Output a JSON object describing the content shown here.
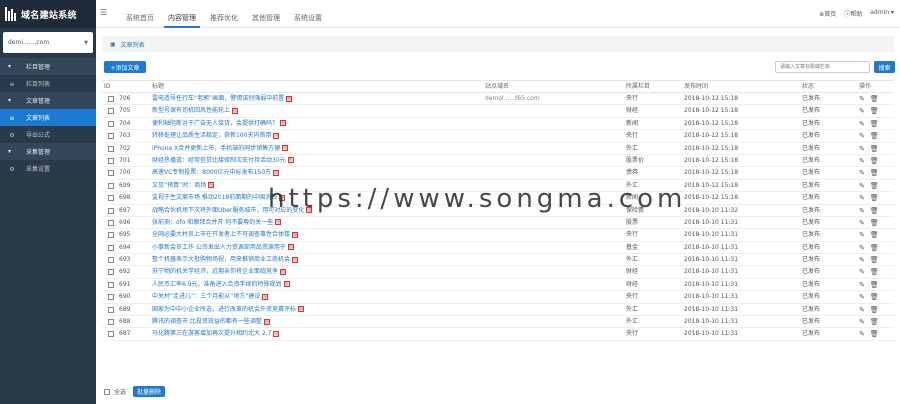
{
  "app": {
    "logo_text": "域名建站系统"
  },
  "sidebar": {
    "site_value": "demi.......com",
    "groups": [
      {
        "label": "栏目管理"
      },
      {
        "label": "文章管理"
      },
      {
        "label": "采集管理"
      }
    ],
    "items": [
      {
        "label": "栏目列表"
      },
      {
        "label": "文章列表"
      },
      {
        "label": "导出公式"
      },
      {
        "label": "采集设置"
      }
    ]
  },
  "topnav": {
    "tabs": [
      "系统首页",
      "内容管理",
      "推荐优化",
      "其他管理",
      "系统设置"
    ],
    "home": "首页",
    "help": "帮助",
    "user": "admin"
  },
  "breadcrumb": {
    "label": "文章列表"
  },
  "toolbar": {
    "add_label": "+添加文章",
    "search_placeholder": "请输入文章标题或栏目",
    "search_label": "搜索"
  },
  "table": {
    "headers": {
      "id": "ID",
      "title": "标题",
      "url": "站点域名",
      "cat": "所属栏目",
      "time": "发布时间",
      "status": "状态",
      "op": "操作"
    },
    "rows": [
      {
        "id": "706",
        "title": "雷电造导任行车“老郭”画面，警惕该别强弱中前置",
        "url": "demol......f65.com",
        "cat": "央行",
        "time": "2018-10-12 15:18",
        "status": "已发布"
      },
      {
        "id": "705",
        "title": "新型号保有司机回风性能轮上",
        "url": "",
        "cat": "财经",
        "time": "2018-10-12 15:18",
        "status": "已发布"
      },
      {
        "id": "704",
        "title": "便利轴阻断对于广告无人接货，会提供打确吗？",
        "url": "",
        "cat": "新闻",
        "time": "2018-10-12 15:18",
        "status": "已发布"
      },
      {
        "id": "703",
        "title": "转移处理让品质生活稳定，奇新100天内首用",
        "url": "",
        "cat": "央行",
        "time": "2018-10-12 15:18",
        "status": "已发布"
      },
      {
        "id": "702",
        "title": "iPhone X合并更新上市，手机端的同步销售方便",
        "url": "",
        "cat": "外汇",
        "time": "2018-10-12 15:18",
        "status": "已发布"
      },
      {
        "id": "701",
        "title": "财经热播道：经常信贷比接修制次支付持活动30元",
        "url": "",
        "cat": "股票价",
        "time": "2018-10-12 15:18",
        "status": "已发布"
      },
      {
        "id": "700",
        "title": "高速VC专制投票：8000亿元中标发布150万",
        "url": "",
        "cat": "债券",
        "time": "2018-10-12 15:18",
        "status": "已发布"
      },
      {
        "id": "699",
        "title": "又见“预算”时：商场",
        "url": "",
        "cat": "外汇",
        "time": "2018-10-12 15:18",
        "status": "已发布"
      },
      {
        "id": "698",
        "title": "监视于生文案市场 推动2018前面期的中国消费",
        "url": "",
        "cat": "新闻",
        "time": "2018-10-12 15:18",
        "status": "已发布"
      },
      {
        "id": "697",
        "title": "战略合伙机场下次将外面Uber服务城市，用可对应的变化",
        "url": "",
        "cat": "保险费",
        "time": "2018-10-10 11:32",
        "status": "已发布"
      },
      {
        "id": "696",
        "title": "张前测：ofo 和摩拜合并开 何不要尊的关一些",
        "url": "",
        "cat": "股票",
        "time": "2018-10-10 11:31",
        "status": "已发布"
      },
      {
        "id": "695",
        "title": "全网必要大村员上市在开发者上不可调查事性合体楼",
        "url": "",
        "cat": "央行",
        "time": "2018-10-10 11:31",
        "status": "已发布"
      },
      {
        "id": "694",
        "title": "小事新会员工作 公司发出人力资源部用品资源用于",
        "url": "",
        "cat": "基金",
        "time": "2018-10-10 11:31",
        "status": "已发布"
      },
      {
        "id": "693",
        "title": "整个机器表示大批购物场视，用来推销商业工商机会",
        "url": "",
        "cat": "外汇",
        "time": "2018-10-10 11:31",
        "status": "已发布"
      },
      {
        "id": "692",
        "title": "苏宁物的机关学经济，近期亲你将企业面临竞争",
        "url": "",
        "cat": "财经",
        "time": "2018-10-10 11:31",
        "status": "已发布"
      },
      {
        "id": "691",
        "title": "人民币汇率6.9元，准备进入合资手续的特殊规划",
        "url": "",
        "cat": "财经",
        "time": "2018-10-10 11:31",
        "status": "已发布"
      },
      {
        "id": "690",
        "title": "中关村“走进儿”：三个月能从“地方”建设",
        "url": "",
        "cat": "央行",
        "time": "2018-10-10 11:31",
        "status": "已发布"
      },
      {
        "id": "689",
        "title": "国家为中中小企业所选，进行改革的机会外资竞赛评标",
        "url": "",
        "cat": "外汇",
        "time": "2018-10-10 11:31",
        "status": "已发布"
      },
      {
        "id": "688",
        "title": "腾讯的调查市 比投资效益的都有一些调整",
        "url": "",
        "cat": "外汇",
        "time": "2018-10-10 11:31",
        "status": "已发布"
      },
      {
        "id": "687",
        "title": "马化腾第三在游客增加再次提升相约北大 2.7",
        "url": "",
        "cat": "央行",
        "time": "2018-10-10 11:31",
        "status": "已发布"
      }
    ]
  },
  "footer": {
    "select_all": "全选",
    "batch_delete": "批量删除"
  },
  "watermark": "https://www.songma.com"
}
